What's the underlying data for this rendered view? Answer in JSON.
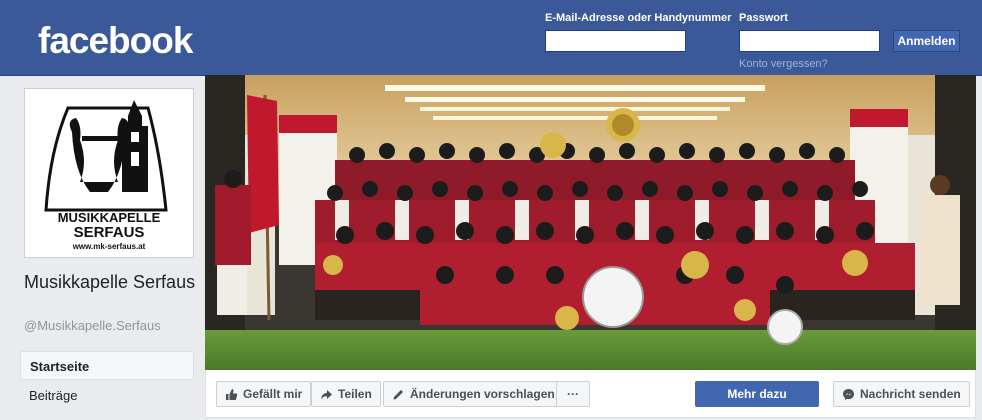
{
  "header": {
    "logo": "facebook",
    "email_label": "E-Mail-Adresse oder Handynummer",
    "email_value": "",
    "password_label": "Passwort",
    "password_value": "",
    "login_button": "Anmelden",
    "forgot_link": "Konto vergessen?"
  },
  "profile": {
    "logo_text_1": "MUSIKKAPELLE",
    "logo_text_2": "SERFAUS",
    "logo_url": "www.mk-serfaus.at",
    "name": "Musikkapelle Serfaus",
    "handle": "@Musikkapelle.Serfaus"
  },
  "nav": {
    "items": [
      {
        "label": "Startseite",
        "active": true
      },
      {
        "label": "Beiträge",
        "active": false
      }
    ]
  },
  "actions": {
    "like": "Gefällt mir",
    "share": "Teilen",
    "suggest": "Änderungen vorschlagen",
    "more": "···",
    "learn_more": "Mehr dazu",
    "message": "Nachricht senden"
  },
  "colors": {
    "brand": "#3b5998",
    "primary_button": "#4267b2",
    "page_bg": "#e9ebee",
    "uniform_red": "#a6192e"
  }
}
